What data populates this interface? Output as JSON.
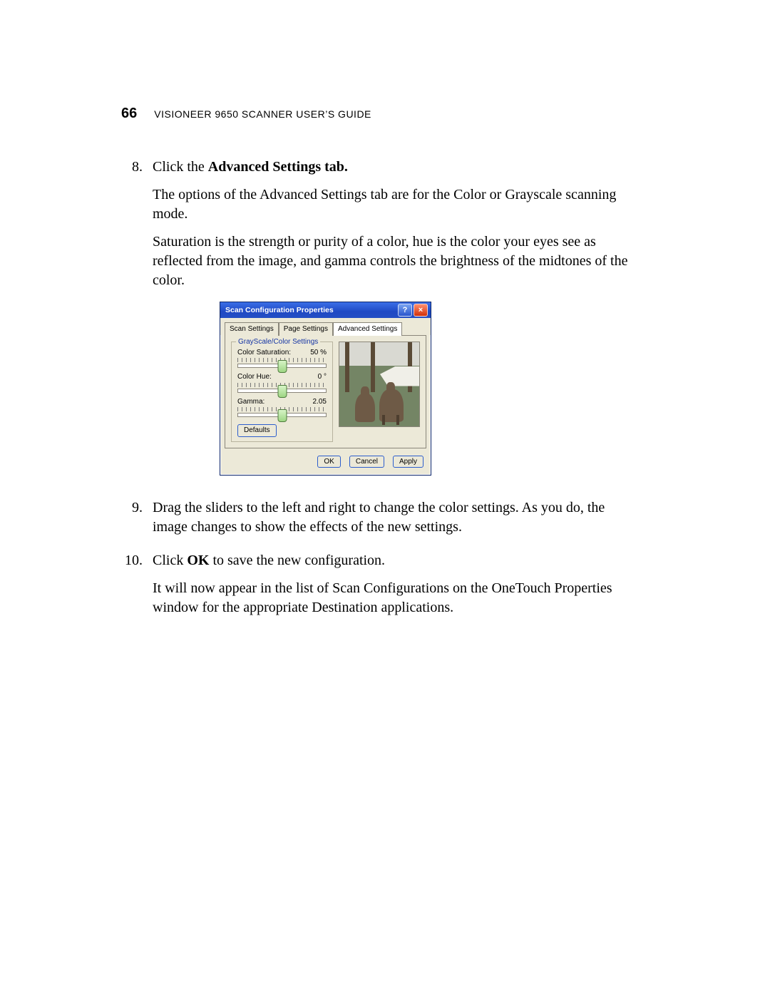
{
  "header": {
    "page_number": "66",
    "guide_title_pre": "V",
    "guide_title_mid": "ISIONEER",
    "guide_title_num": " 9650 S",
    "guide_title_sc1": "CANNER",
    "guide_title_u": " U",
    "guide_title_sc2": "SER",
    "guide_title_ap": "’",
    "guide_title_s": "S",
    "guide_title_g": " G",
    "guide_title_sc3": "UIDE"
  },
  "steps": {
    "n8": "8.",
    "n9": "9.",
    "n10": "10.",
    "s8_line1a": "Click the ",
    "s8_line1b": "Advanced Settings tab.",
    "s8_p2": "The options of the Advanced Settings tab are for the Color or Grayscale scanning mode.",
    "s8_p3": "Saturation is the strength or purity of a color, hue is the color your eyes see as reflected from the image, and gamma controls the brightness of the midtones of the color.",
    "s9": "Drag the sliders to the left and right to change the color settings. As you do, the image changes to show the effects of the new settings.",
    "s10a": "Click ",
    "s10b": "OK",
    "s10c": " to save the new configuration.",
    "s10p2": "It will now appear in the list of Scan Configurations on the OneTouch Properties window for the appropriate Destination applications."
  },
  "dialog": {
    "title": "Scan Configuration Properties",
    "tabs": {
      "scan": "Scan Settings",
      "page": "Page Settings",
      "adv": "Advanced Settings"
    },
    "group_legend": "GrayScale/Color Settings",
    "sliders": {
      "sat_label": "Color Saturation:",
      "sat_value": "50 %",
      "hue_label": "Color Hue:",
      "hue_value": "0 °",
      "gamma_label": "Gamma:",
      "gamma_value": "2.05"
    },
    "defaults": "Defaults",
    "buttons": {
      "ok": "OK",
      "cancel": "Cancel",
      "apply": "Apply"
    }
  }
}
